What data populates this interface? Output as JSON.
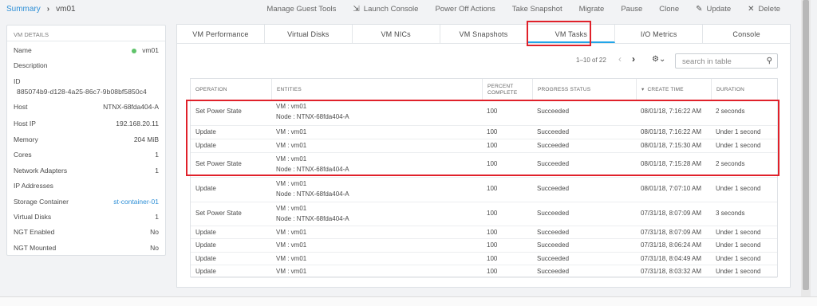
{
  "breadcrumb": {
    "link": "Summary",
    "current": "vm01"
  },
  "actions": [
    {
      "label": "Manage Guest Tools",
      "icon": ""
    },
    {
      "label": "Launch Console",
      "icon": "⇲"
    },
    {
      "label": "Power Off Actions",
      "icon": ""
    },
    {
      "label": "Take Snapshot",
      "icon": ""
    },
    {
      "label": "Migrate",
      "icon": ""
    },
    {
      "label": "Pause",
      "icon": ""
    },
    {
      "label": "Clone",
      "icon": ""
    },
    {
      "label": "Update",
      "icon": "✎"
    },
    {
      "label": "Delete",
      "icon": "✕"
    }
  ],
  "vm_details": {
    "heading": "VM DETAILS",
    "rows": [
      {
        "label": "Name",
        "value": "vm01"
      },
      {
        "label": "Description",
        "value": ""
      },
      {
        "label": "ID",
        "value": ""
      },
      {
        "label": "Host",
        "value": "NTNX-68fda404-A"
      },
      {
        "label": "Host IP",
        "value": "192.168.20.11"
      },
      {
        "label": "Memory",
        "value": "204 MiB"
      },
      {
        "label": "Cores",
        "value": "1"
      },
      {
        "label": "Network Adapters",
        "value": "1"
      },
      {
        "label": "IP Addresses",
        "value": ""
      },
      {
        "label": "Storage Container",
        "value": "st-container-01"
      },
      {
        "label": "Virtual Disks",
        "value": "1"
      },
      {
        "label": "NGT Enabled",
        "value": "No"
      },
      {
        "label": "NGT Mounted",
        "value": "No"
      }
    ],
    "id_value": "885074b9-d128-4a25-86c7-9b08bf5850c4"
  },
  "tabs": [
    "VM Performance",
    "Virtual Disks",
    "VM NICs",
    "VM Snapshots",
    "VM Tasks",
    "I/O Metrics",
    "Console"
  ],
  "active_tab": "VM Tasks",
  "pager": {
    "text": "1–10 of 22",
    "prev": "‹",
    "next": "›",
    "gear": "⚙⌄"
  },
  "search": {
    "placeholder": "search in table",
    "value": ""
  },
  "table": {
    "headers": [
      "OPERATION",
      "ENTITIES",
      "PERCENT\nCOMPLETE",
      "PROGRESS STATUS",
      "▾  CREATE TIME",
      "DURATION"
    ],
    "rows": [
      {
        "op": "Set Power State",
        "e1": "VM : vm01",
        "e2": "Node : NTNX-68fda404-A",
        "pct": "100",
        "status": "Succeeded",
        "time": "08/01/18, 7:16:22 AM",
        "dur": "2 seconds"
      },
      {
        "op": "Update",
        "e1": "VM : vm01",
        "e2": "",
        "pct": "100",
        "status": "Succeeded",
        "time": "08/01/18, 7:16:22 AM",
        "dur": "Under 1 second"
      },
      {
        "op": "Update",
        "e1": "VM : vm01",
        "e2": "",
        "pct": "100",
        "status": "Succeeded",
        "time": "08/01/18, 7:15:30 AM",
        "dur": "Under 1 second"
      },
      {
        "op": "Set Power State",
        "e1": "VM : vm01",
        "e2": "Node : NTNX-68fda404-A",
        "pct": "100",
        "status": "Succeeded",
        "time": "08/01/18, 7:15:28 AM",
        "dur": "2 seconds"
      },
      {
        "op": "Update",
        "e1": "VM : vm01",
        "e2": "Node : NTNX-68fda404-A",
        "pct": "100",
        "status": "Succeeded",
        "time": "08/01/18, 7:07:10 AM",
        "dur": "Under 1 second"
      },
      {
        "op": "Set Power State",
        "e1": "VM : vm01",
        "e2": "Node : NTNX-68fda404-A",
        "pct": "100",
        "status": "Succeeded",
        "time": "07/31/18, 8:07:09 AM",
        "dur": "3 seconds"
      },
      {
        "op": "Update",
        "e1": "VM : vm01",
        "e2": "",
        "pct": "100",
        "status": "Succeeded",
        "time": "07/31/18, 8:07:09 AM",
        "dur": "Under 1 second"
      },
      {
        "op": "Update",
        "e1": "VM : vm01",
        "e2": "",
        "pct": "100",
        "status": "Succeeded",
        "time": "07/31/18, 8:06:24 AM",
        "dur": "Under 1 second"
      },
      {
        "op": "Update",
        "e1": "VM : vm01",
        "e2": "",
        "pct": "100",
        "status": "Succeeded",
        "time": "07/31/18, 8:04:49 AM",
        "dur": "Under 1 second"
      },
      {
        "op": "Update",
        "e1": "VM : vm01",
        "e2": "",
        "pct": "100",
        "status": "Succeeded",
        "time": "07/31/18, 8:03:32 AM",
        "dur": "Under 1 second"
      }
    ]
  },
  "colors": {
    "accent": "#22a5e8",
    "link": "#2e8fd6",
    "highlight": "#e0212a",
    "status_dot": "#5fc36a"
  }
}
